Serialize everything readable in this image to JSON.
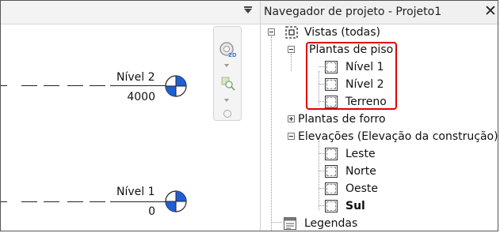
{
  "canvas": {
    "levels": [
      {
        "name": "Nível 2",
        "elevation": "4000"
      },
      {
        "name": "Nível 1",
        "elevation": "0"
      }
    ]
  },
  "browser": {
    "title": "Navegador de projeto - Projeto1",
    "close_glyph": "✕",
    "root": "Vistas (todas)",
    "floor_plans": "Plantas de piso",
    "floor_plan_items": [
      "Nível 1",
      "Nível 2",
      "Terreno"
    ],
    "ceiling_plans": "Plantas de forro",
    "elevations": "Elevações (Elevação da construção)",
    "elevation_items": [
      "Leste",
      "Norte",
      "Oeste",
      "Sul"
    ],
    "legends": "Legendas"
  },
  "colors": {
    "highlight": "#e00000",
    "level_head_blue": "#1f5fd6"
  },
  "icons": {
    "panel_menu": "dropdown-menu-icon",
    "steering_wheel": "steering-wheel-2d-icon",
    "zoom": "zoom-region-icon"
  }
}
